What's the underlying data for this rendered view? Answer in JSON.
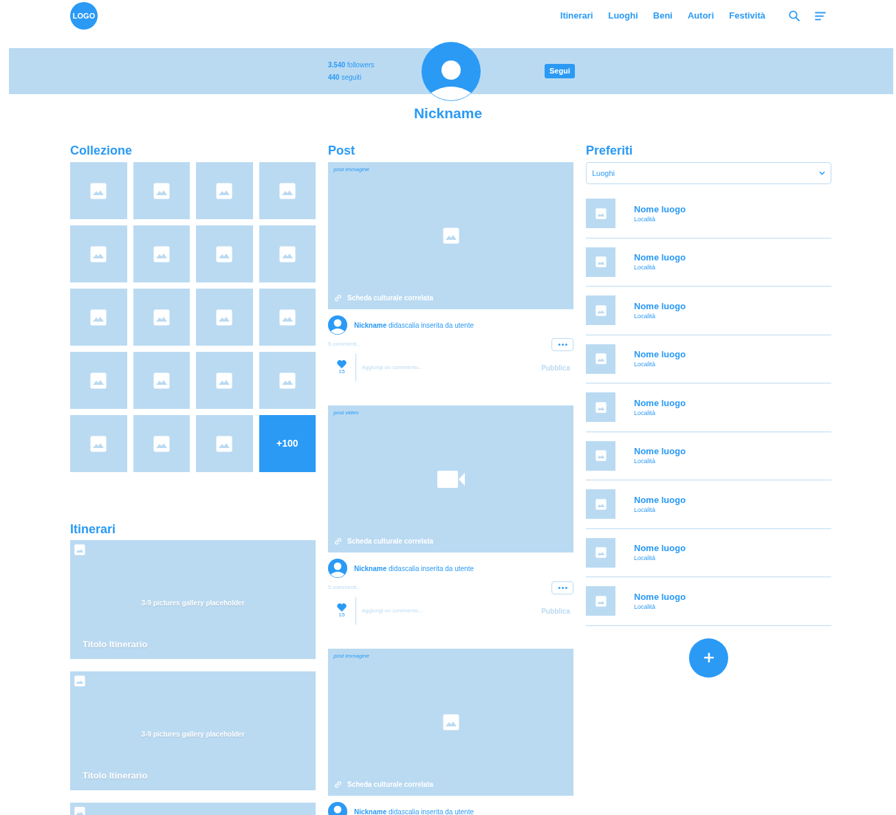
{
  "header": {
    "logo": "LOGO",
    "nav": [
      {
        "label": "Itinerari"
      },
      {
        "label": "Luoghi"
      },
      {
        "label": "Beni"
      },
      {
        "label": "Autori"
      },
      {
        "label": "Festività"
      }
    ]
  },
  "profile": {
    "followers": "**3.540** followers",
    "following": "**440** seguiti",
    "follow_button": "Segui",
    "nickname": "Nickname"
  },
  "collection": {
    "title": "Collezione",
    "tiles": [
      {
        "kind": "image"
      },
      {
        "kind": "image"
      },
      {
        "kind": "image"
      },
      {
        "kind": "image"
      },
      {
        "kind": "image"
      },
      {
        "kind": "image"
      },
      {
        "kind": "image"
      },
      {
        "kind": "image"
      },
      {
        "kind": "image"
      },
      {
        "kind": "image"
      },
      {
        "kind": "image"
      },
      {
        "kind": "image"
      },
      {
        "kind": "image"
      },
      {
        "kind": "image"
      },
      {
        "kind": "image"
      },
      {
        "kind": "image"
      },
      {
        "kind": "image"
      },
      {
        "kind": "image"
      },
      {
        "kind": "image"
      },
      {
        "kind": "more",
        "label": "+100"
      }
    ]
  },
  "itineraries": {
    "title": "Itinerari",
    "cards": [
      {
        "kind": "gallery",
        "gallery_text": "3-9 pictures gallery placeholder",
        "title": "Titolo Itinerario"
      },
      {
        "kind": "gallery",
        "gallery_text": "3-9 pictures gallery placeholder",
        "title": "Titolo Itinerario"
      },
      {
        "kind": "partial"
      }
    ]
  },
  "posts": {
    "title": "Post",
    "items": [
      {
        "type_label": "post immagine",
        "kind": "image",
        "link": "Scheda culturale correlata",
        "caption": "**Nickname** didascalia inserita da utente",
        "comments": "5 commenti...",
        "likes": "15",
        "comment_placeholder": "Aggiungi un commento...",
        "publish": "Pubblica"
      },
      {
        "type_label": "post video",
        "kind": "video",
        "link": "Scheda culturale correlata",
        "caption": "**Nickname** didascalia inserita da utente",
        "comments": "5 commenti...",
        "likes": "15",
        "comment_placeholder": "Aggiungi un commento...",
        "publish": "Pubblica"
      },
      {
        "type_label": "post immagine",
        "kind": "image",
        "link": "Scheda culturale correlata",
        "caption": "**Nickname** didascalia inserita da utente"
      }
    ]
  },
  "favorites": {
    "title": "Preferiti",
    "select": "Luoghi",
    "items": [
      {
        "name": "Nome luogo",
        "place": "Località"
      },
      {
        "name": "Nome luogo",
        "place": "Località"
      },
      {
        "name": "Nome luogo",
        "place": "Località"
      },
      {
        "name": "Nome luogo",
        "place": "Località"
      },
      {
        "name": "Nome luogo",
        "place": "Località"
      },
      {
        "name": "Nome luogo",
        "place": "Località"
      },
      {
        "name": "Nome luogo",
        "place": "Località"
      },
      {
        "name": "Nome luogo",
        "place": "Località"
      },
      {
        "name": "Nome luogo",
        "place": "Località"
      }
    ]
  }
}
